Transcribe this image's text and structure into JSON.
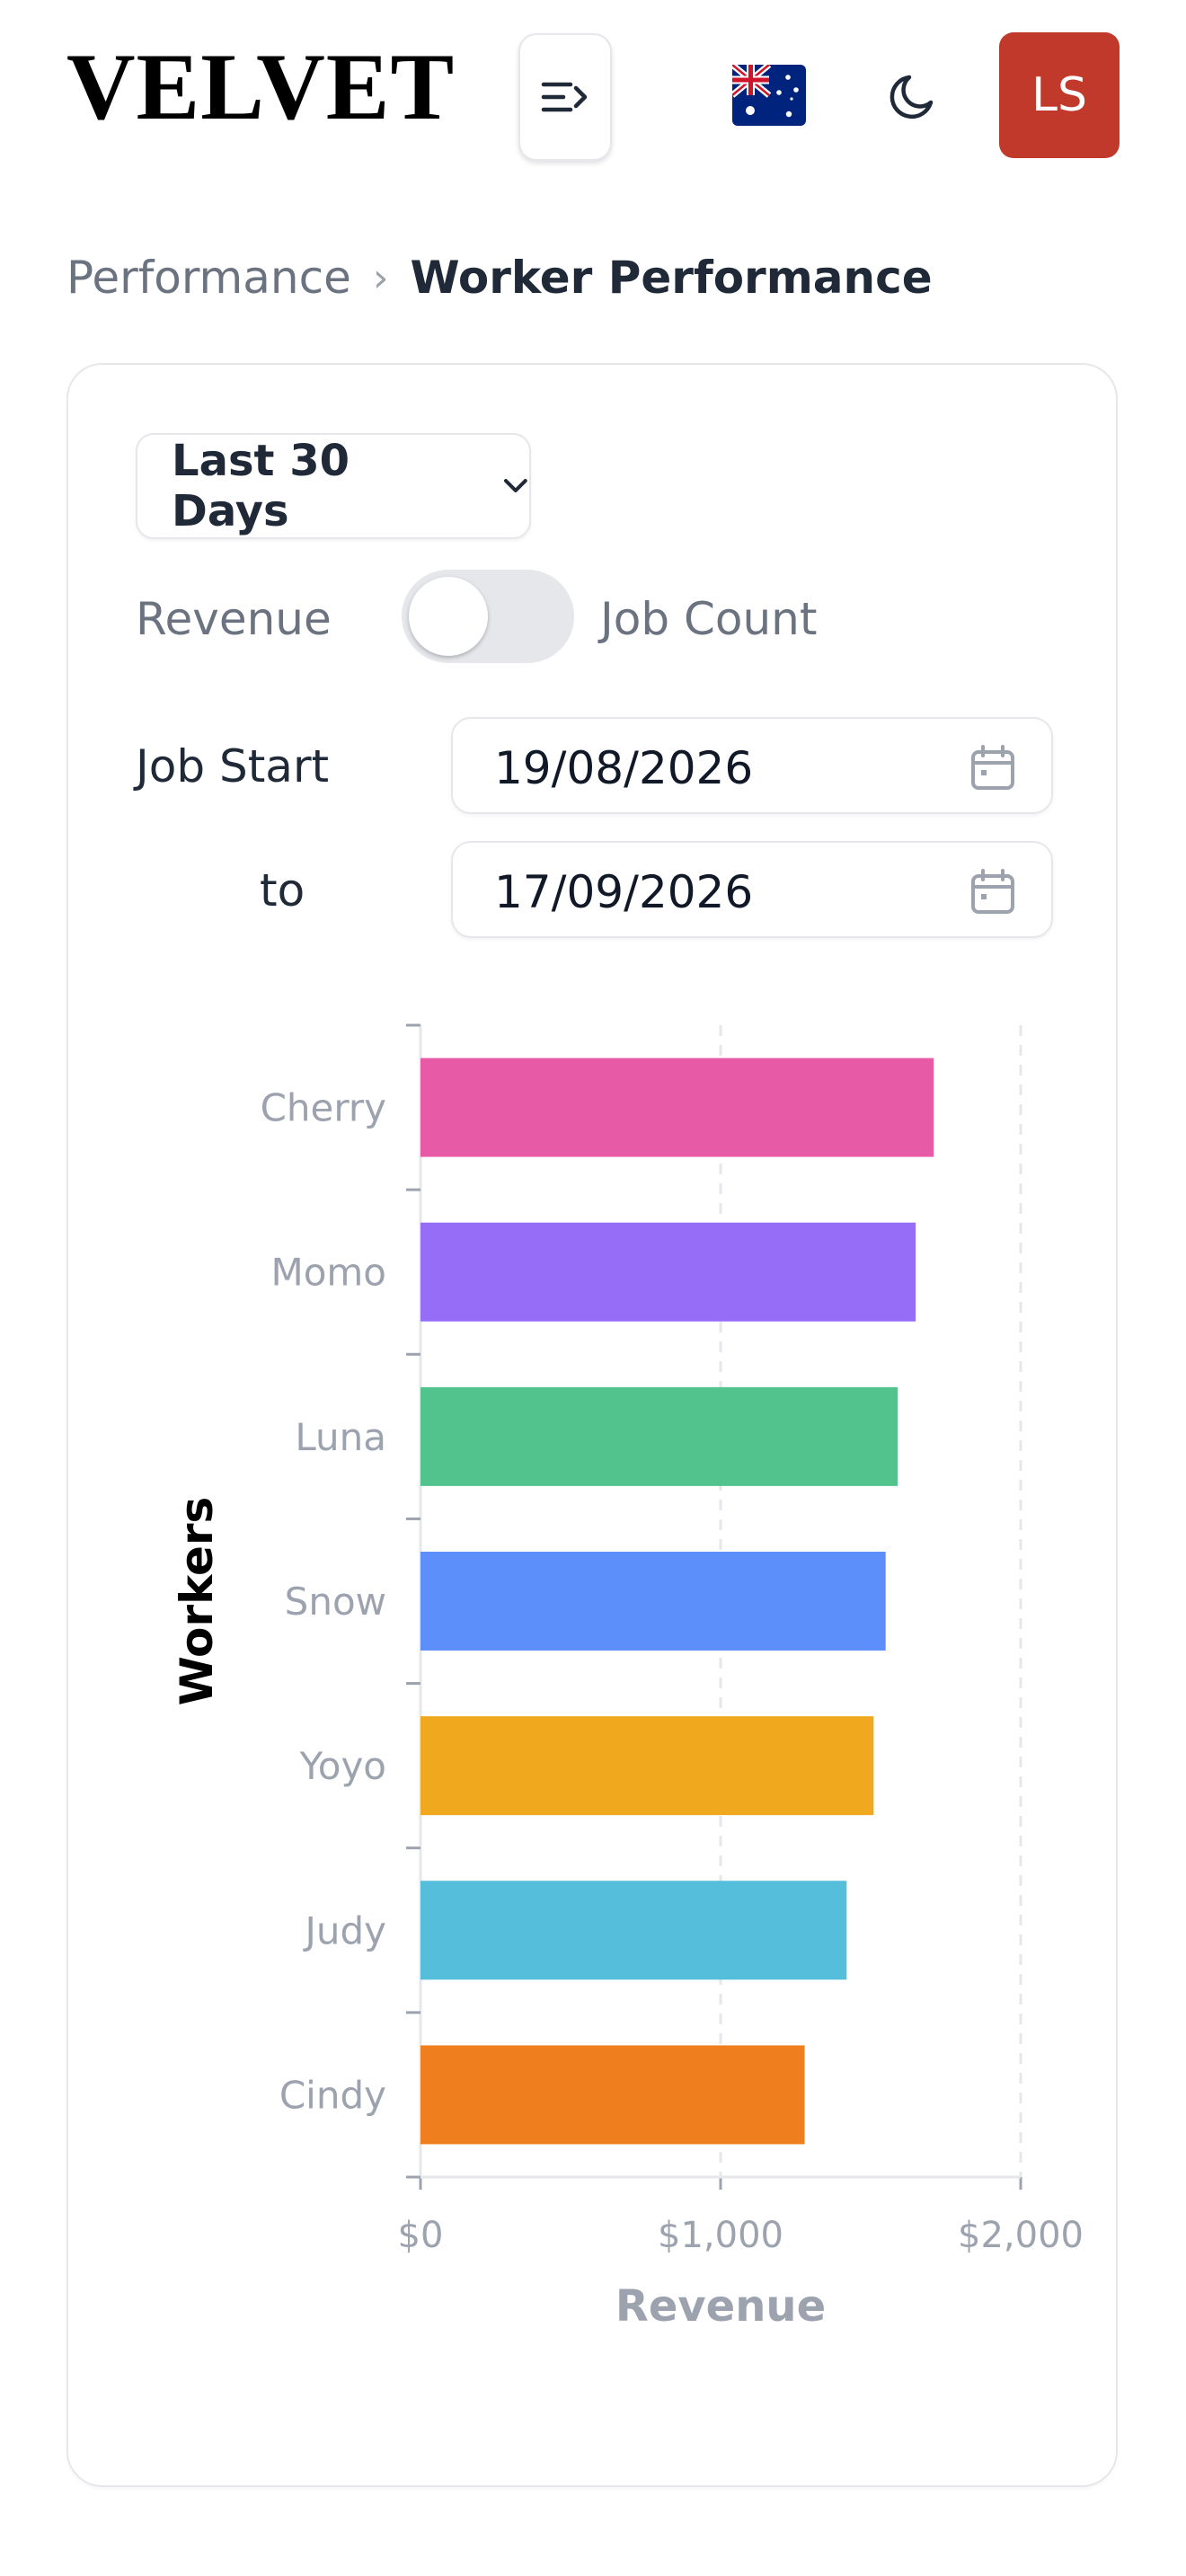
{
  "header": {
    "logo": "VELVET",
    "menu_icon": "menu-arrow-icon",
    "flag_icon": "australia-flag-icon",
    "theme_icon": "moon-icon",
    "avatar_initials": "LS",
    "avatar_color": "#c0392b"
  },
  "breadcrumb": {
    "parent": "Performance",
    "separator": "›",
    "current": "Worker Performance"
  },
  "filters": {
    "range": "Last 30 Days",
    "toggle": {
      "left_label": "Revenue",
      "right_label": "Job Count",
      "on": false
    },
    "job_start_label": "Job Start",
    "to_label": "to",
    "start_date": "19/08/2026",
    "end_date": "17/09/2026"
  },
  "chart_data": {
    "type": "bar",
    "orientation": "horizontal",
    "categories": [
      "Cherry",
      "Momo",
      "Luna",
      "Snow",
      "Yoyo",
      "Judy",
      "Cindy"
    ],
    "values": [
      1710,
      1650,
      1590,
      1550,
      1510,
      1420,
      1280
    ],
    "colors": [
      "#e75aa5",
      "#956df7",
      "#52c38c",
      "#5c8ff9",
      "#f0a81e",
      "#54bedb",
      "#ef7f1e"
    ],
    "xlabel": "Revenue",
    "ylabel": "Workers",
    "xlim": [
      0,
      2000
    ],
    "xticks": [
      "$0",
      "$1,000",
      "$2,000"
    ],
    "grid": true
  }
}
